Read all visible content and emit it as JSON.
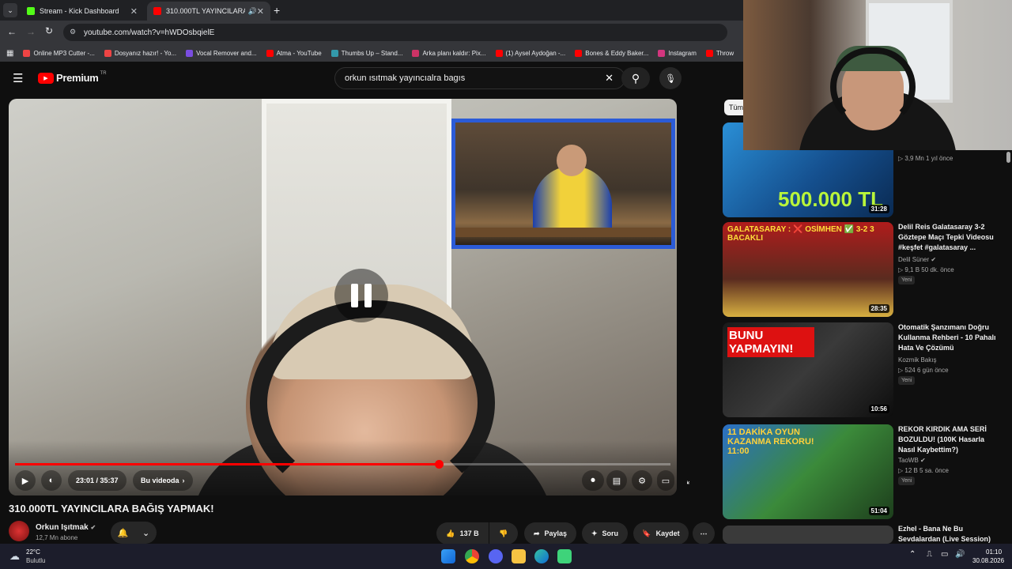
{
  "browser": {
    "tabs": [
      {
        "title": "Stream - Kick Dashboard",
        "active": false,
        "icon": "kick-icon",
        "color": "#53fc18"
      },
      {
        "title": "310.000TL YAYINCILARA BA",
        "active": true,
        "icon": "youtube-icon",
        "color": "#ff0000"
      }
    ],
    "url": "youtube.com/watch?v=hWDOsbqielE",
    "bookmarks": [
      {
        "label": "Online MP3 Cutter -...",
        "color": "#e44"
      },
      {
        "label": "Dosyanız hazır! - Yo...",
        "color": "#e44"
      },
      {
        "label": "Vocal Remover and...",
        "color": "#7a4de0"
      },
      {
        "label": "Atma - YouTube",
        "color": "#f00"
      },
      {
        "label": "Thumbs Up – Stand...",
        "color": "#39a"
      },
      {
        "label": "Arka planı kaldır: Pix...",
        "color": "#c36"
      },
      {
        "label": "(1) Aysel Aydoğan -...",
        "color": "#f00"
      },
      {
        "label": "Bones & Eddy Baker...",
        "color": "#f00"
      },
      {
        "label": "Instagram",
        "color": "#d3367f"
      },
      {
        "label": "Throw",
        "color": "#f00"
      }
    ]
  },
  "youtube": {
    "logo": "Premium",
    "region": "TR",
    "search_query": "orkun ısıtmak yayıncıalra bagıs"
  },
  "player": {
    "current_time": "23:01",
    "duration": "35:37",
    "time_label": "23:01 / 35:37",
    "chapter": "Bu videoda",
    "progress_fraction": 0.646
  },
  "video": {
    "title": "310.000TL YAYINCILARA BAĞIŞ YAPMAK!",
    "channel": "Orkun Işıtmak",
    "subscribers": "12,7 Mn abone",
    "likes": "137 B",
    "share_label": "Paylaş",
    "ask_label": "Soru",
    "save_label": "Kaydet"
  },
  "sidebar": {
    "chip": "Tüm",
    "videos": [
      {
        "thumb_text": "500.000 TL",
        "duration": "31:28",
        "title": "",
        "channel": "",
        "meta": "3,9 Mn   1 yıl önce",
        "badge": ""
      },
      {
        "thumb_text": "GALATASARAY : ❌ OSİMHEN ✅ 3-2 3 BACAKLI",
        "duration": "28:35",
        "title": "Delil Reis Galatasaray 3-2 Göztepe Maçı Tepki Videosu #keşfet #galatasaray ...",
        "channel": "Delil Süner",
        "meta": "9,1 B   50 dk. önce",
        "badge": "Yeni"
      },
      {
        "thumb_text": "BUNU YAPMAYIN!",
        "duration": "10:56",
        "title": "Otomatik Şanzımanı Doğru Kullanma Rehberi - 10 Pahalı Hata Ve Çözümü",
        "channel": "Kozmik Bakış",
        "meta": "524   6 gün önce",
        "badge": "Yeni"
      },
      {
        "thumb_text": "11 DAKİKA OYUN KAZANMA REKORU! 11:00",
        "duration": "51:04",
        "title": "REKOR KIRDIK AMA SERİ BOZULDU! (100K Hasarla Nasıl Kaybettim?)",
        "channel": "TaoWB",
        "meta": "12 B   5 sa. önce",
        "badge": "Yeni"
      },
      {
        "thumb_text": "",
        "duration": "",
        "title": "Ezhel - Bana Ne Bu Sevdalardan (Live Session)",
        "channel": "",
        "meta": "",
        "badge": ""
      }
    ]
  },
  "taskbar": {
    "temperature": "22°C",
    "weather": "Bulutlu",
    "time": "01:10",
    "date": "30.08.2026"
  }
}
